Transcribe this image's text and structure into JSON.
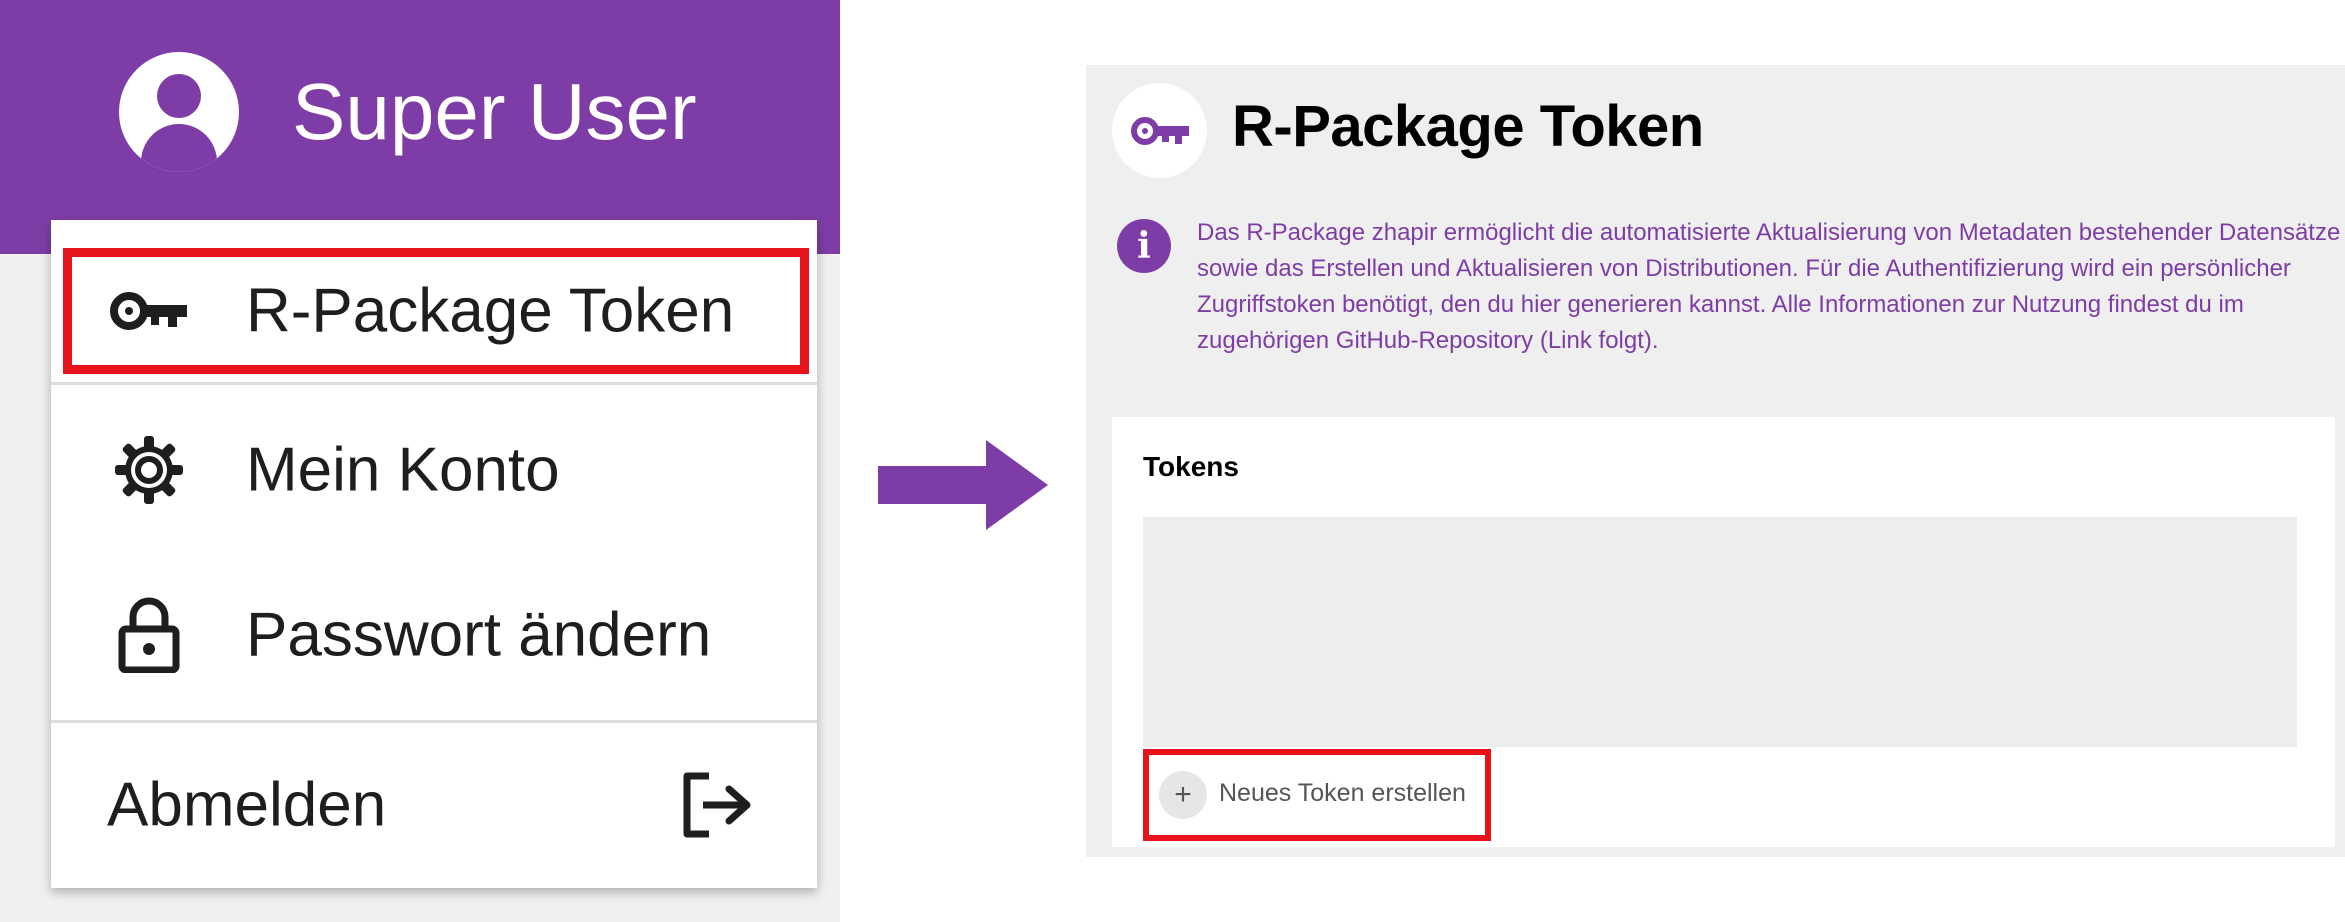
{
  "user_menu": {
    "user_name": "Super User",
    "items": [
      {
        "label": "R-Package Token",
        "icon": "key-icon",
        "highlighted": true
      },
      {
        "label": "Mein Konto",
        "icon": "gear-icon"
      },
      {
        "label": "Passwort ändern",
        "icon": "lock-icon"
      }
    ],
    "logout": {
      "label": "Abmelden",
      "icon": "logout-icon"
    }
  },
  "arrow": {
    "icon": "arrow-right-icon"
  },
  "token_page": {
    "title": "R-Package Token",
    "title_icon": "key-icon",
    "info_icon": "info-icon",
    "info_text": "Das R-Package zhapir ermöglicht die automatisierte Aktualisierung von Metadaten bestehender Datensätze sowie das Erstellen und Aktualisieren von Distributionen. Für die Authentifizierung wird ein persönlicher Zugriffstoken benötigt, den du hier generieren kannst. Alle Informationen zur Nutzung findest du im zugehörigen GitHub-Repository (Link folgt).",
    "tokens_heading": "Tokens",
    "new_token_label": "Neues Token erstellen",
    "new_token_icon": "plus-icon"
  },
  "colors": {
    "brand_purple": "#7e3da6",
    "highlight_red": "#e8141c",
    "panel_gray": "#efefef"
  }
}
